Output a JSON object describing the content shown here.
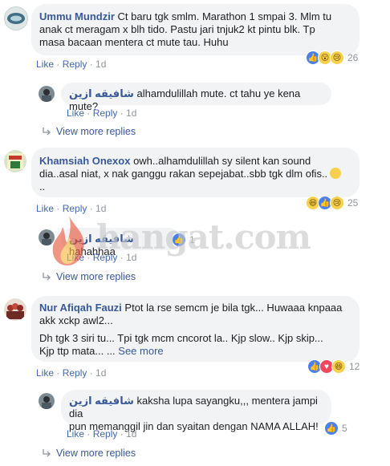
{
  "watermark": {
    "text": "hangat.com"
  },
  "comments": [
    {
      "name": "Ummu Mundzir",
      "text_line1": "Ct baru tgk smlm. Marathon 1 smpai 3. Mlm tu",
      "text_line2": "anak ct meragam x blh tido. Pastu jari tnjuk2 kt pintu blk. Tp",
      "text_line3": "masa bacaan mentera ct mute tau. Huhu",
      "like": "Like",
      "reply": "Reply",
      "time": "1d",
      "reactions": {
        "icons": [
          "like-icon",
          "wow-icon",
          "sad-icon"
        ],
        "count": "26"
      }
    },
    {
      "name": "شافيقه ازين",
      "text": "alhamdulillah mute. ct tahu ye kena mute?",
      "like": "Like",
      "reply": "Reply",
      "time": "1d"
    },
    {
      "view_more": "View more replies"
    },
    {
      "name": "Khamsiah Onexox",
      "text_line1": "owh..alhamdulillah sy silent kan sound",
      "text_line2": "dia..asal niat, x nak ganggu rakan sepejabat..sbb tgk dlm ofis..",
      "text_line3": "..",
      "like": "Like",
      "reply": "Reply",
      "time": "1d",
      "reactions": {
        "icons": [
          "haha-icon",
          "like-icon",
          "sad-icon"
        ],
        "count": "25"
      }
    },
    {
      "name": "شافيقه ازين",
      "text": "hahahhaa",
      "like": "Like",
      "reply": "Reply",
      "time": "1d",
      "reactions": {
        "icons": [
          "like-icon"
        ],
        "count": "1"
      }
    },
    {
      "view_more": "View more replies"
    },
    {
      "name": "Nur Afiqah Fauzi",
      "text_line1": "Ptot la rse semcm je bila tgk... Huwaaa knpaaa",
      "text_line2": "akk xckp awl2...",
      "text_line3": "Dh tgk 3 siri tu... Tpi tgk mcm cncorot la.. Kjp slow.. Kjp skip...",
      "text_line4": "Kjp ttp mata... ...",
      "see_more": "See more",
      "like": "Like",
      "reply": "Reply",
      "time": "1d",
      "reactions": {
        "icons": [
          "like-icon",
          "love-icon",
          "haha-icon"
        ],
        "count": "12"
      }
    },
    {
      "name": "شافيقه ازين",
      "text_line1": "kaksha lupa sayangku,,, mentera jampi dia",
      "text_line2": "pun memanggil jin dan syaitan dengan NAMA ALLAH!",
      "like": "Like",
      "reply": "Reply",
      "time": "1d",
      "reactions": {
        "icons": [
          "like-icon"
        ],
        "count": "5"
      }
    },
    {
      "view_more": "View more replies"
    }
  ],
  "colors": {
    "link": "#385898",
    "action": "#4267b2",
    "meta": "#90949c",
    "bubble": "#f2f3f5"
  }
}
